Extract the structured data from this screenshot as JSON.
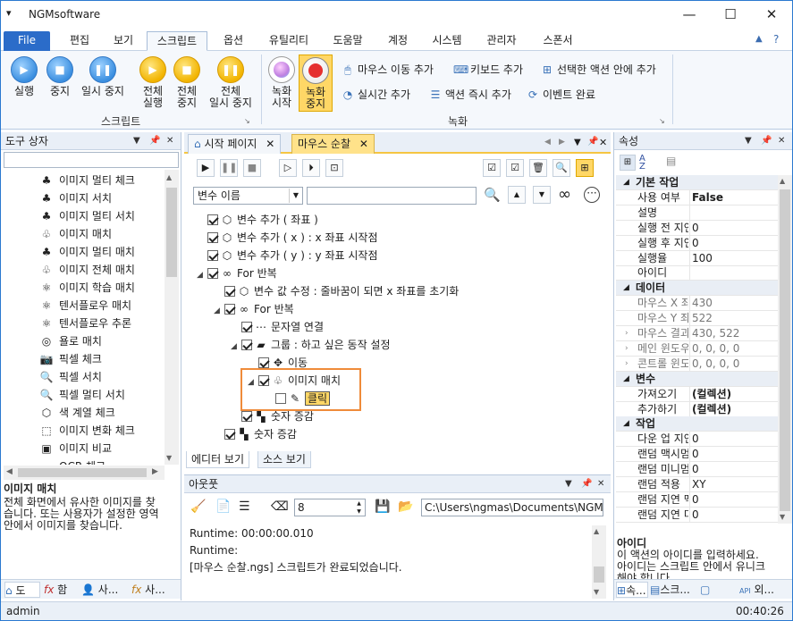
{
  "window": {
    "title": "NGMsoftware",
    "minimize": "—",
    "maximize": "☐",
    "close": "✕"
  },
  "menu": {
    "file": "File",
    "tabs": [
      "편집",
      "보기",
      "스크립트",
      "옵션",
      "유틸리티",
      "도움말",
      "계정",
      "시스템",
      "관리자",
      "스폰서"
    ],
    "active_tab": "스크립트"
  },
  "ribbon": {
    "script_group": {
      "label": "스크립트",
      "run": "실행",
      "stop": "중지",
      "pause": "일시 중지",
      "run_all_1": "전체",
      "run_all_2": "실행",
      "stop_all_1": "전체",
      "stop_all_2": "중지",
      "pause_all_1": "전체",
      "pause_all_2": "일시 중지"
    },
    "record_group": {
      "label": "녹화",
      "record_start_1": "녹화",
      "record_start_2": "시작",
      "record_stop_1": "녹화",
      "record_stop_2": "중지",
      "add_mouse_move": "마우스 이동 추가",
      "add_keyboard": "키보드 추가",
      "add_to_selected": "선택한 액션 안에 추가",
      "add_realtime": "실시간 추가",
      "add_action_now": "액션 즉시 추가",
      "event_done": "이벤트 완료"
    }
  },
  "toolbox": {
    "title": "도구 상자",
    "items": [
      {
        "label": "이미지 멀티 체크",
        "icon": "tree-icon"
      },
      {
        "label": "이미지 서치",
        "icon": "tree-icon"
      },
      {
        "label": "이미지 멀티 서치",
        "icon": "trees-icon"
      },
      {
        "label": "이미지 매치",
        "icon": "trees-outline-icon"
      },
      {
        "label": "이미지 멀티 매치",
        "icon": "trees-icon"
      },
      {
        "label": "이미지 전체 매치",
        "icon": "trees-outline-icon"
      },
      {
        "label": "이미지 학습 매치",
        "icon": "atom-icon"
      },
      {
        "label": "텐서플로우 매치",
        "icon": "atom-icon"
      },
      {
        "label": "텐서플로우 추론",
        "icon": "atom-icon"
      },
      {
        "label": "욜로 매치",
        "icon": "target-icon"
      },
      {
        "label": "픽셀 체크",
        "icon": "camera-icon"
      },
      {
        "label": "픽셀 서치",
        "icon": "magnifier-icon"
      },
      {
        "label": "픽셀 멀티 서치",
        "icon": "magnifier-icon"
      },
      {
        "label": "색 계열 체크",
        "icon": "cube-icon"
      },
      {
        "label": "이미지 변화 체크",
        "icon": "change-icon"
      },
      {
        "label": "이미지 비교",
        "icon": "compare-icon"
      },
      {
        "label": "OCR 체크",
        "icon": "ocr-icon"
      }
    ],
    "desc_title": "이미지 매치",
    "desc_lines": [
      "전체 화면에서 유사한 이미지를 찾",
      "습니다. 또는 사용자가 설정한 영역",
      "안에서 이미지를 찾습니다."
    ],
    "bottom_tabs": [
      "도",
      "함",
      "사...",
      "사..."
    ]
  },
  "editor": {
    "tabs": [
      "시작 페이지",
      "마우스 순찰"
    ],
    "active_tab": "마우스 순찰",
    "search_select": "변수 이름",
    "search_value": "",
    "tree": [
      {
        "text": "변수 추가 ( 좌표 )",
        "depth": 0,
        "checked": true,
        "icon": "cube-icon",
        "exp": ""
      },
      {
        "text": "변수 추가 ( x ) : x 좌표 시작점",
        "depth": 0,
        "checked": true,
        "icon": "cube-icon",
        "exp": ""
      },
      {
        "text": "변수 추가 ( y ) : y 좌표 시작점",
        "depth": 0,
        "checked": true,
        "icon": "cube-icon",
        "exp": ""
      },
      {
        "text": "For 반복",
        "depth": 0,
        "checked": true,
        "icon": "infinity-icon",
        "exp": "◢"
      },
      {
        "text": "변수 값 수정 : 줄바꿈이 되면 x 좌표를 초기화",
        "depth": 1,
        "checked": true,
        "icon": "cube-icon",
        "exp": ""
      },
      {
        "text": "For 반복",
        "depth": 1,
        "checked": true,
        "icon": "infinity-icon",
        "exp": "◢"
      },
      {
        "text": "문자열 연결",
        "depth": 2,
        "checked": true,
        "icon": "dots-icon",
        "exp": ""
      },
      {
        "text": "그룹 : 하고 싶은 동작 설정",
        "depth": 2,
        "checked": true,
        "icon": "group-icon",
        "exp": "◢"
      },
      {
        "text": "이동",
        "depth": 3,
        "checked": true,
        "icon": "move-icon",
        "exp": ""
      },
      {
        "text": "이미지 매치",
        "depth": 3,
        "checked": true,
        "icon": "trees-outline-icon",
        "exp": "◢"
      },
      {
        "text": "클릭",
        "depth": 4,
        "checked": false,
        "icon": "click-icon",
        "exp": ""
      },
      {
        "text": "숫자 증감",
        "depth": 2,
        "checked": true,
        "icon": "counter-icon",
        "exp": ""
      },
      {
        "text": "숫자 증감",
        "depth": 1,
        "checked": true,
        "icon": "counter-icon",
        "exp": ""
      }
    ],
    "bottom_tabs": [
      "에디터 보기",
      "소스 보기"
    ]
  },
  "output": {
    "title": "아웃풋",
    "count": "8",
    "path": "C:\\Users\\ngmas\\Documents\\NGM6\\",
    "lines": [
      "Runtime: 00:00:00.010",
      "Runtime:",
      "[마우스 순찰.ngs] 스크립트가 완료되었습니다."
    ]
  },
  "properties": {
    "title": "속성",
    "rows": [
      {
        "type": "cat",
        "key": "기본 작업"
      },
      {
        "type": "row",
        "key": "사용 여부",
        "value": "False",
        "bold": true
      },
      {
        "type": "row",
        "key": "설명",
        "value": ""
      },
      {
        "type": "row",
        "key": "실행 전 지연",
        "value": "0"
      },
      {
        "type": "row",
        "key": "실행 후 지연",
        "value": "0"
      },
      {
        "type": "row",
        "key": "실행율",
        "value": "100"
      },
      {
        "type": "row",
        "key": "아이디",
        "value": ""
      },
      {
        "type": "cat",
        "key": "데이터"
      },
      {
        "type": "row",
        "key": "마우스 X 좌표",
        "value": "430",
        "gray": true
      },
      {
        "type": "row",
        "key": "마우스 Y 좌표",
        "value": "522",
        "gray": true
      },
      {
        "type": "row",
        "key": "마우스 결과",
        "value": "430, 522",
        "gray": true,
        "exp": true
      },
      {
        "type": "row",
        "key": "메인 윈도우",
        "value": "0, 0, 0, 0",
        "gray": true,
        "exp": true
      },
      {
        "type": "row",
        "key": "콘트롤 윈도우",
        "value": "0, 0, 0, 0",
        "gray": true,
        "exp": true
      },
      {
        "type": "cat",
        "key": "변수"
      },
      {
        "type": "row",
        "key": "가져오기",
        "value": "(컬렉션)",
        "bold": true
      },
      {
        "type": "row",
        "key": "추가하기",
        "value": "(컬렉션)",
        "bold": true
      },
      {
        "type": "cat",
        "key": "작업"
      },
      {
        "type": "row",
        "key": "다운 업 지연",
        "value": "0"
      },
      {
        "type": "row",
        "key": "랜덤 맥시멈",
        "value": "0"
      },
      {
        "type": "row",
        "key": "랜덤 미니멈",
        "value": "0"
      },
      {
        "type": "row",
        "key": "랜덤 적용",
        "value": "XY"
      },
      {
        "type": "row",
        "key": "랜덤 지연 맥",
        "value": "0"
      },
      {
        "type": "row",
        "key": "랜덤 지연 미",
        "value": "0"
      }
    ],
    "desc_title": "아이디",
    "desc_lines": [
      "이 액션의 아이디를 입력하세요.",
      "아이디는 스크립트 안에서 유니크",
      "해야 합니다."
    ],
    "bottom_tabs": [
      "속...",
      "스크...",
      "",
      "외..."
    ]
  },
  "status": {
    "user": "admin",
    "time": "00:40:26"
  }
}
